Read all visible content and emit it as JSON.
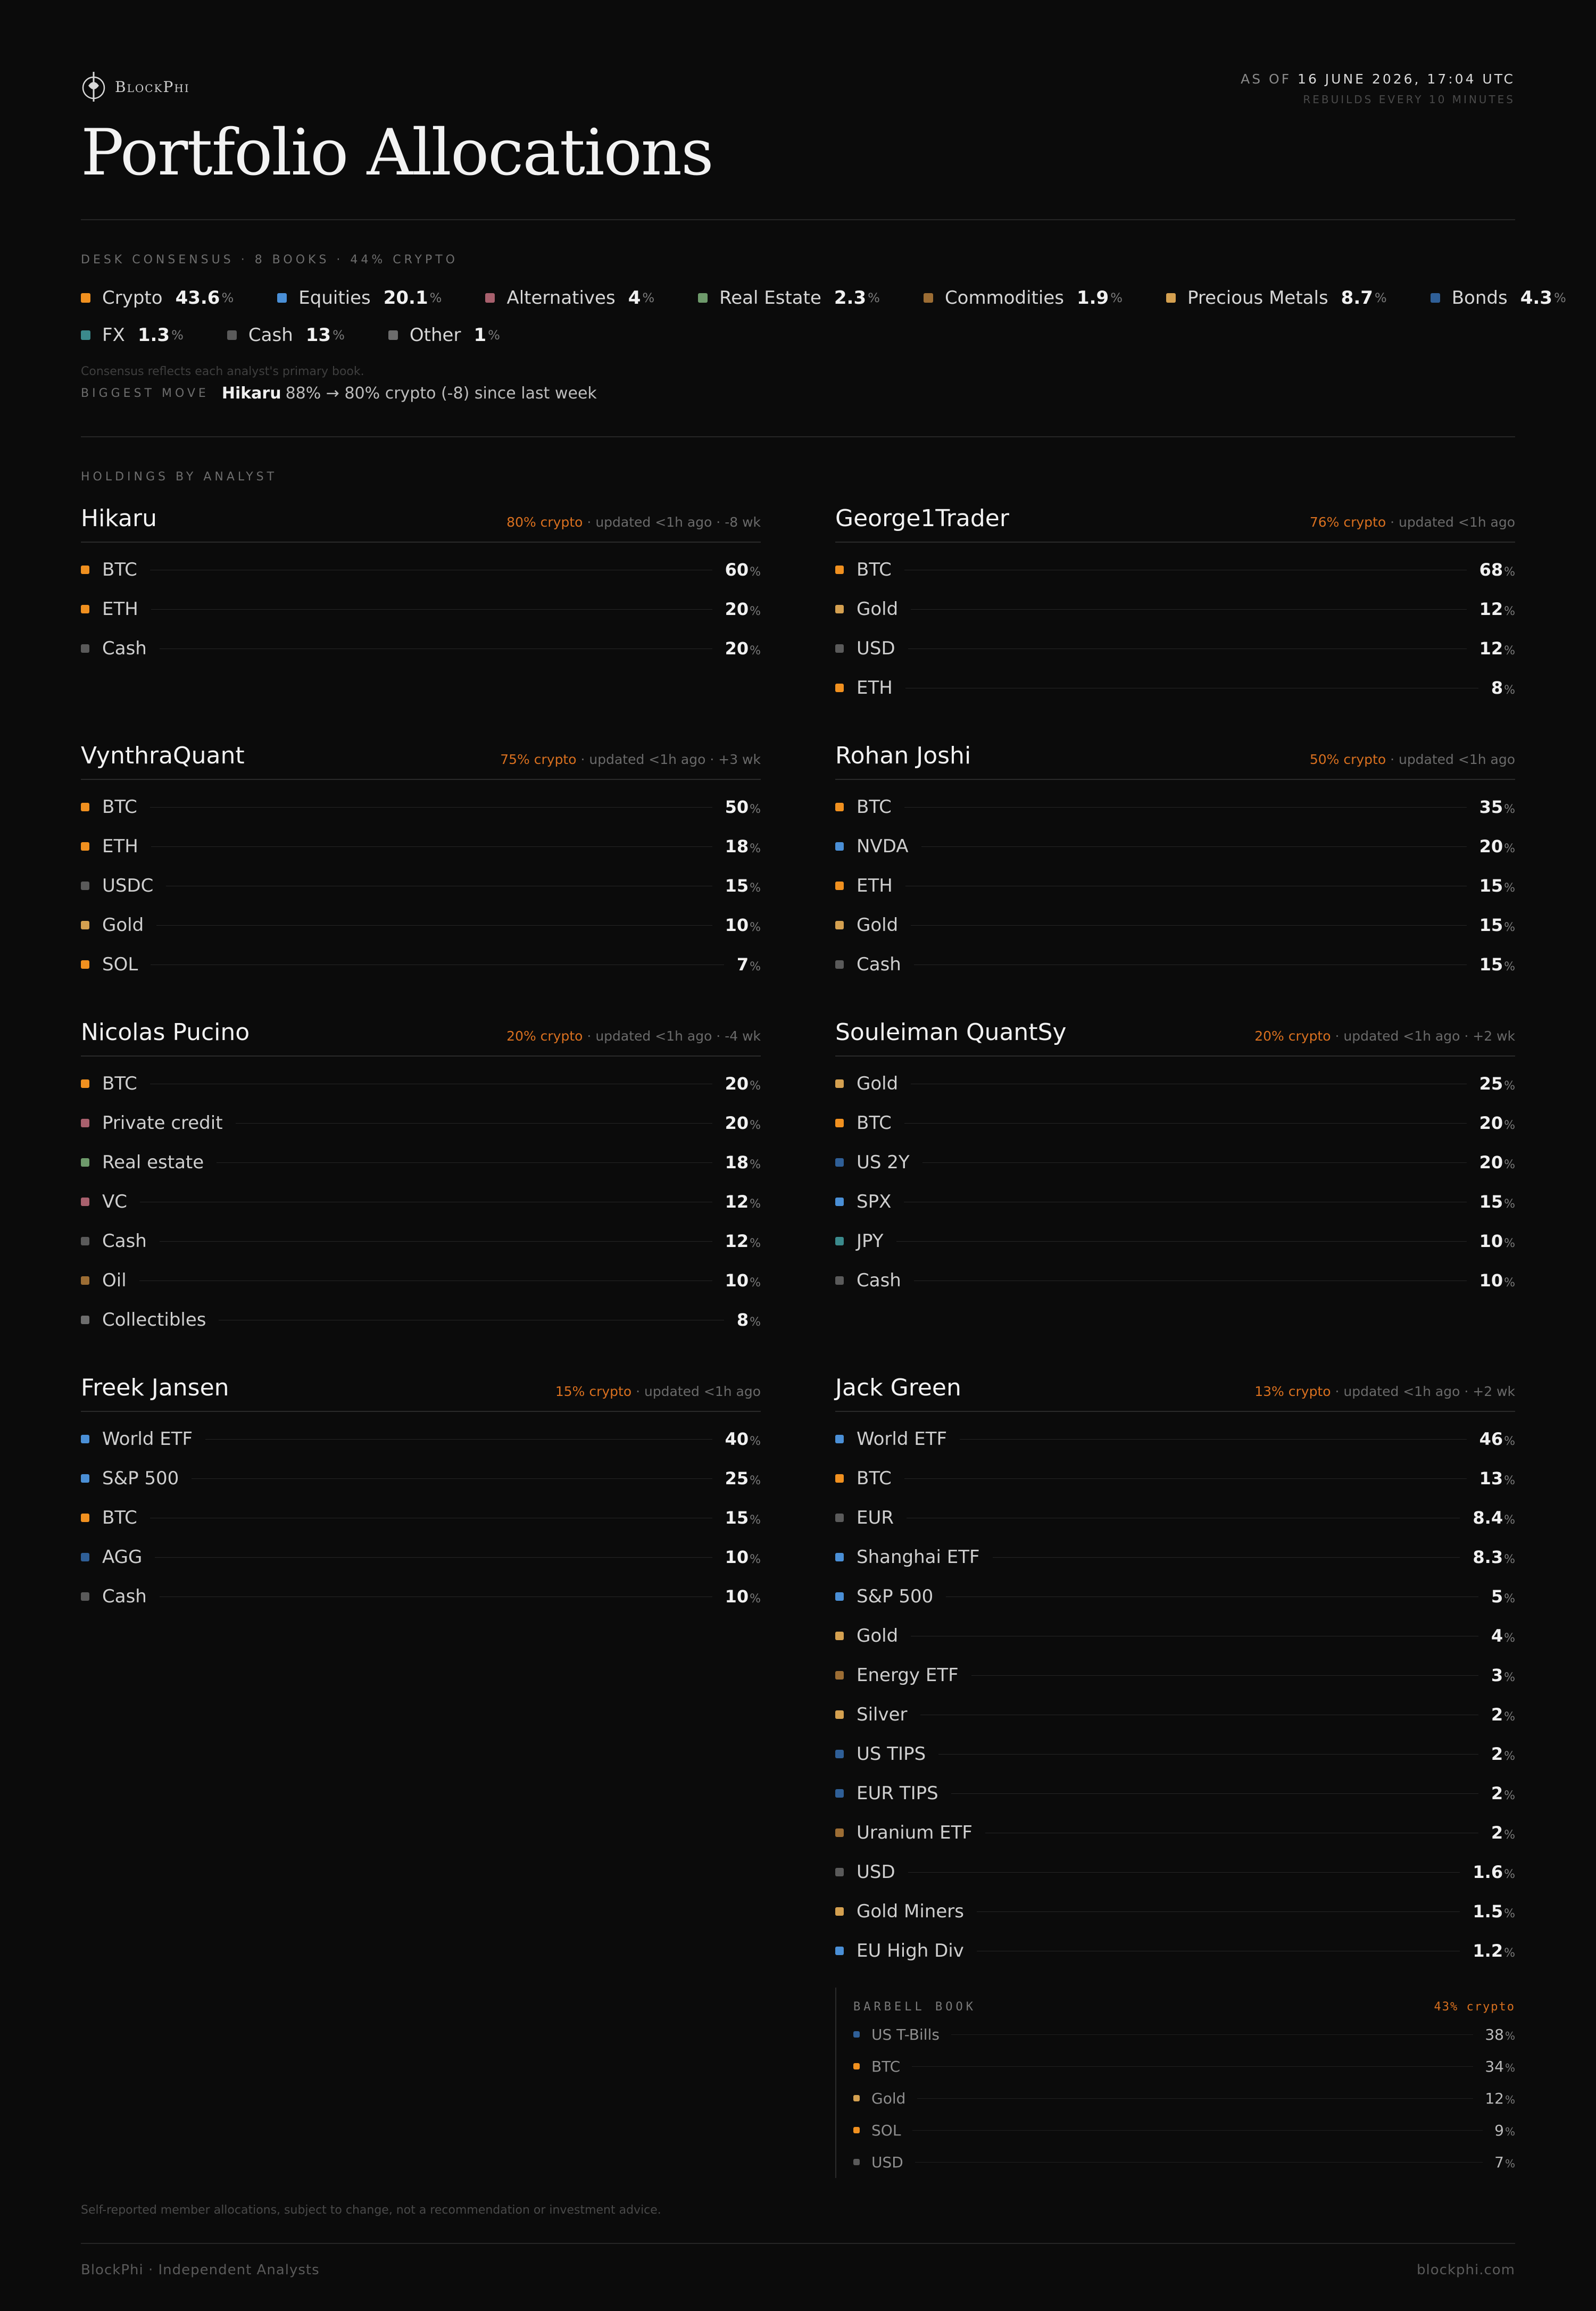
{
  "brand": {
    "name": "BlockPhi"
  },
  "header": {
    "asof_label": "AS OF",
    "asof_value": "16 JUNE 2026, 17:04 UTC",
    "rebuild": "REBUILDS EVERY 10 MINUTES",
    "title": "Portfolio Allocations"
  },
  "consensus": {
    "eyebrow": "DESK CONSENSUS · 8 BOOKS · 44% CRYPTO",
    "unit": "%",
    "items": [
      {
        "label": "Crypto",
        "value": "43.6",
        "color": "#f0901f"
      },
      {
        "label": "Equities",
        "value": "20.1",
        "color": "#4a8fd6"
      },
      {
        "label": "Alternatives",
        "value": "4",
        "color": "#a8606d"
      },
      {
        "label": "Real Estate",
        "value": "2.3",
        "color": "#6e9a6b"
      },
      {
        "label": "Commodities",
        "value": "1.9",
        "color": "#9c6d34"
      },
      {
        "label": "Precious Metals",
        "value": "8.7",
        "color": "#d4a050"
      },
      {
        "label": "Bonds",
        "value": "4.3",
        "color": "#2f5f97"
      },
      {
        "label": "FX",
        "value": "1.3",
        "color": "#3b8a8c"
      },
      {
        "label": "Cash",
        "value": "13",
        "color": "#5a5a5a"
      },
      {
        "label": "Other",
        "value": "1",
        "color": "#6d6d6d"
      }
    ],
    "note": "Consensus reflects each analyst's primary book.",
    "biggest_move_label": "BIGGEST MOVE",
    "biggest_move_name": "Hikaru",
    "biggest_move_text": "88% → 80% crypto (-8) since last week"
  },
  "holdings": {
    "eyebrow": "HOLDINGS BY ANALYST",
    "unit": "%",
    "analysts": [
      {
        "name": "Hikaru",
        "crypto": "80% crypto",
        "rest": "updated <1h ago · -8 wk",
        "items": [
          {
            "asset": "BTC",
            "pct": "60",
            "color": "#f0901f"
          },
          {
            "asset": "ETH",
            "pct": "20",
            "color": "#f0901f"
          },
          {
            "asset": "Cash",
            "pct": "20",
            "color": "#5a5a5a"
          }
        ]
      },
      {
        "name": "George1Trader",
        "crypto": "76% crypto",
        "rest": "updated <1h ago",
        "items": [
          {
            "asset": "BTC",
            "pct": "68",
            "color": "#f0901f"
          },
          {
            "asset": "Gold",
            "pct": "12",
            "color": "#d4a050"
          },
          {
            "asset": "USD",
            "pct": "12",
            "color": "#5a5a5a"
          },
          {
            "asset": "ETH",
            "pct": "8",
            "color": "#f0901f"
          }
        ]
      },
      {
        "name": "VynthraQuant",
        "crypto": "75% crypto",
        "rest": "updated <1h ago · +3 wk",
        "items": [
          {
            "asset": "BTC",
            "pct": "50",
            "color": "#f0901f"
          },
          {
            "asset": "ETH",
            "pct": "18",
            "color": "#f0901f"
          },
          {
            "asset": "USDC",
            "pct": "15",
            "color": "#5a5a5a"
          },
          {
            "asset": "Gold",
            "pct": "10",
            "color": "#d4a050"
          },
          {
            "asset": "SOL",
            "pct": "7",
            "color": "#f0901f"
          }
        ]
      },
      {
        "name": "Rohan Joshi",
        "crypto": "50% crypto",
        "rest": "updated <1h ago",
        "items": [
          {
            "asset": "BTC",
            "pct": "35",
            "color": "#f0901f"
          },
          {
            "asset": "NVDA",
            "pct": "20",
            "color": "#4a8fd6"
          },
          {
            "asset": "ETH",
            "pct": "15",
            "color": "#f0901f"
          },
          {
            "asset": "Gold",
            "pct": "15",
            "color": "#d4a050"
          },
          {
            "asset": "Cash",
            "pct": "15",
            "color": "#5a5a5a"
          }
        ]
      },
      {
        "name": "Nicolas Pucino",
        "crypto": "20% crypto",
        "rest": "updated <1h ago · -4 wk",
        "items": [
          {
            "asset": "BTC",
            "pct": "20",
            "color": "#f0901f"
          },
          {
            "asset": "Private credit",
            "pct": "20",
            "color": "#a8606d"
          },
          {
            "asset": "Real estate",
            "pct": "18",
            "color": "#6e9a6b"
          },
          {
            "asset": "VC",
            "pct": "12",
            "color": "#a8606d"
          },
          {
            "asset": "Cash",
            "pct": "12",
            "color": "#5a5a5a"
          },
          {
            "asset": "Oil",
            "pct": "10",
            "color": "#9c6d34"
          },
          {
            "asset": "Collectibles",
            "pct": "8",
            "color": "#6d6d6d"
          }
        ]
      },
      {
        "name": "Souleiman QuantSy",
        "crypto": "20% crypto",
        "rest": "updated <1h ago · +2 wk",
        "items": [
          {
            "asset": "Gold",
            "pct": "25",
            "color": "#d4a050"
          },
          {
            "asset": "BTC",
            "pct": "20",
            "color": "#f0901f"
          },
          {
            "asset": "US 2Y",
            "pct": "20",
            "color": "#2f5f97"
          },
          {
            "asset": "SPX",
            "pct": "15",
            "color": "#4a8fd6"
          },
          {
            "asset": "JPY",
            "pct": "10",
            "color": "#3b8a8c"
          },
          {
            "asset": "Cash",
            "pct": "10",
            "color": "#5a5a5a"
          }
        ]
      },
      {
        "name": "Freek Jansen",
        "crypto": "15% crypto",
        "rest": "updated <1h ago",
        "items": [
          {
            "asset": "World ETF",
            "pct": "40",
            "color": "#4a8fd6"
          },
          {
            "asset": "S&P 500",
            "pct": "25",
            "color": "#4a8fd6"
          },
          {
            "asset": "BTC",
            "pct": "15",
            "color": "#f0901f"
          },
          {
            "asset": "AGG",
            "pct": "10",
            "color": "#2f5f97"
          },
          {
            "asset": "Cash",
            "pct": "10",
            "color": "#5a5a5a"
          }
        ]
      },
      {
        "name": "Jack Green",
        "crypto": "13% crypto",
        "rest": "updated <1h ago · +2 wk",
        "items": [
          {
            "asset": "World ETF",
            "pct": "46",
            "color": "#4a8fd6"
          },
          {
            "asset": "BTC",
            "pct": "13",
            "color": "#f0901f"
          },
          {
            "asset": "EUR",
            "pct": "8.4",
            "color": "#5a5a5a"
          },
          {
            "asset": "Shanghai ETF",
            "pct": "8.3",
            "color": "#4a8fd6"
          },
          {
            "asset": "S&P 500",
            "pct": "5",
            "color": "#4a8fd6"
          },
          {
            "asset": "Gold",
            "pct": "4",
            "color": "#d4a050"
          },
          {
            "asset": "Energy ETF",
            "pct": "3",
            "color": "#9c6d34"
          },
          {
            "asset": "Silver",
            "pct": "2",
            "color": "#d4a050"
          },
          {
            "asset": "US TIPS",
            "pct": "2",
            "color": "#2f5f97"
          },
          {
            "asset": "EUR TIPS",
            "pct": "2",
            "color": "#2f5f97"
          },
          {
            "asset": "Uranium ETF",
            "pct": "2",
            "color": "#9c6d34"
          },
          {
            "asset": "USD",
            "pct": "1.6",
            "color": "#5a5a5a"
          },
          {
            "asset": "Gold Miners",
            "pct": "1.5",
            "color": "#d4a050"
          },
          {
            "asset": "EU High Div",
            "pct": "1.2",
            "color": "#4a8fd6"
          }
        ]
      }
    ]
  },
  "barbell": {
    "title": "BARBELL BOOK",
    "crypto": "43% crypto",
    "items": [
      {
        "asset": "US T-Bills",
        "pct": "38",
        "color": "#2f5f97"
      },
      {
        "asset": "BTC",
        "pct": "34",
        "color": "#f0901f"
      },
      {
        "asset": "Gold",
        "pct": "12",
        "color": "#d4a050"
      },
      {
        "asset": "SOL",
        "pct": "9",
        "color": "#f0901f"
      },
      {
        "asset": "USD",
        "pct": "7",
        "color": "#5a5a5a"
      }
    ]
  },
  "footer": {
    "disclaimer": "Self-reported member allocations, subject to change, not a recommendation or investment advice.",
    "left": "BlockPhi · Independent Analysts",
    "right": "blockphi.com"
  }
}
